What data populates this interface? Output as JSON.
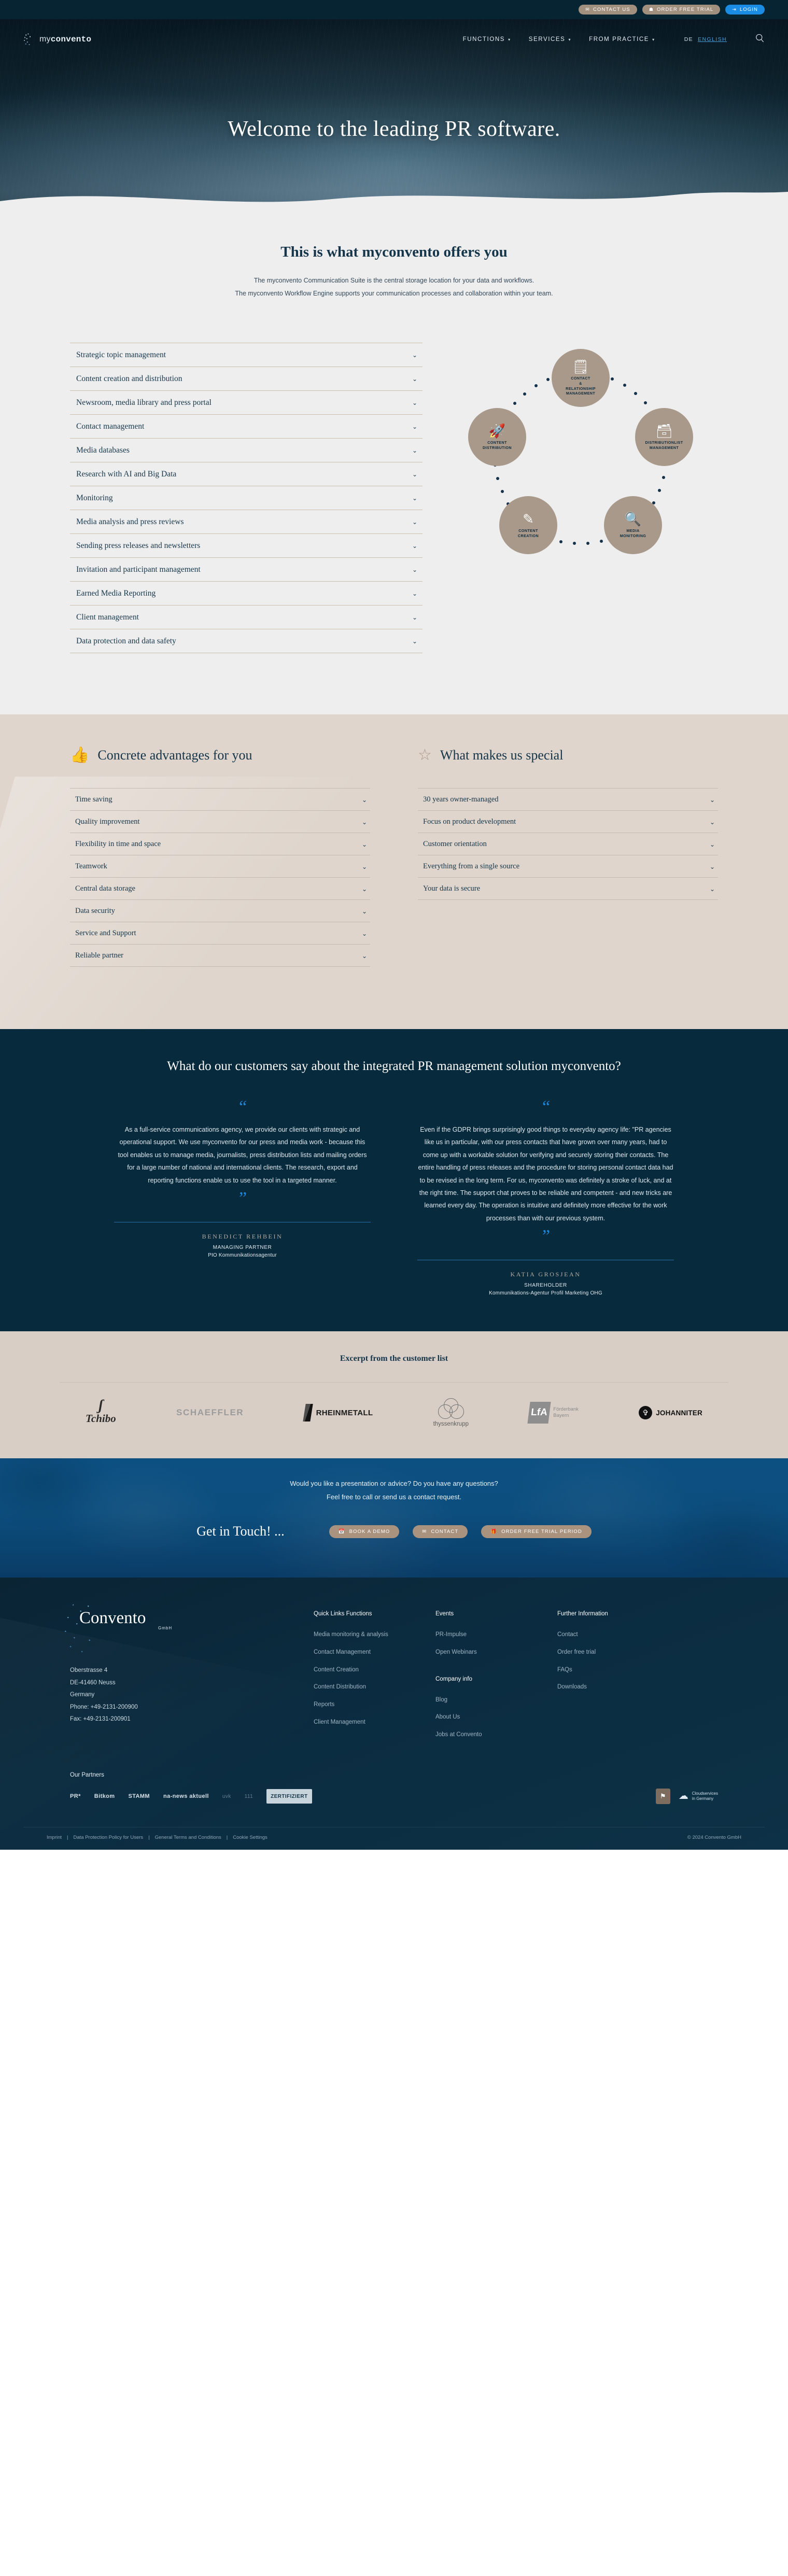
{
  "topbar": {
    "buttons": [
      {
        "label": "CONTACT US",
        "icon": "envelope-icon",
        "glyph": "✉",
        "style": "tan"
      },
      {
        "label": "ORDER FREE TRIAL",
        "icon": "gift-icon",
        "glyph": "☗",
        "style": "tan"
      },
      {
        "label": "LOGIN",
        "icon": "login-arrow-icon",
        "glyph": "→]",
        "style": "blue"
      }
    ]
  },
  "nav": {
    "logo_my": "my",
    "logo_convento": "convento",
    "links": [
      {
        "label": "FUNCTIONS",
        "caret": "⌄"
      },
      {
        "label": "SERVICES",
        "caret": "⌄"
      },
      {
        "label": "FROM PRACTICE",
        "caret": "⌄"
      }
    ],
    "lang_de": "DE",
    "lang_en": "ENGLISH"
  },
  "hero": {
    "title": "Welcome to the leading PR software."
  },
  "offers": {
    "title": "This is what myconvento offers you",
    "sub_line1": "The myconvento Communication Suite is the central storage location for your data and workflows.",
    "sub_line2": "The myconvento Workflow Engine supports your communication processes and collaboration within your team.",
    "accordion": [
      "Strategic topic management",
      "Content creation and distribution",
      "Newsroom, media library and press portal",
      "Contact management",
      "Media databases",
      "Research with AI and Big Data",
      "Monitoring",
      "Media analysis and press reviews",
      "Sending press releases and newsletters",
      "Invitation and participant management",
      "Earned Media Reporting",
      "Client management",
      "Data protection and data safety"
    ],
    "chevron": "⌄",
    "diagram": {
      "nodes": [
        {
          "label": "CONTACT\n&\nRELATIONSHIP\nMANAGEMENT",
          "icon": "address-book-icon",
          "glyph": "📖"
        },
        {
          "label": "DISTRIBUTIONLIST\nMANAGEMENT",
          "icon": "card-stack-icon",
          "glyph": "🗂"
        },
        {
          "label": "MEDIA\nMONITORING",
          "icon": "binoculars-icon",
          "glyph": "🔭"
        },
        {
          "label": "CONTENT\nCREATION",
          "icon": "pen-icon",
          "glyph": "✎"
        },
        {
          "label": "CONTENT\nDISTRIBUTION",
          "icon": "rocket-icon",
          "glyph": "🚀"
        }
      ]
    }
  },
  "advantages": {
    "left": {
      "icon": "thumbs-up-icon",
      "glyph": "👍",
      "title": "Concrete advantages for you",
      "items": [
        "Time saving",
        "Quality improvement",
        "Flexibility in time and space",
        "Teamwork",
        "Central data storage",
        "Data security",
        "Service and Support",
        "Reliable partner"
      ]
    },
    "right": {
      "icon": "star-outline-icon",
      "glyph": "☆",
      "title": "What makes us special",
      "items": [
        "30 years owner-managed",
        "Focus on product development",
        "Customer orientation",
        "Everything from a single source",
        "Your data is secure"
      ]
    },
    "chevron": "⌄"
  },
  "testimonials": {
    "heading": "What do our customers say about the integrated PR management solution myconvento?",
    "quote_open": "“",
    "quote_close": "”",
    "cards": [
      {
        "quote": "As a full-service communications agency, we provide our clients with strategic and operational support. We use myconvento for our press and media work - because this tool enables us to manage media, journalists, press distribution lists and mailing orders for a large number of national and international clients. The research, export and reporting functions enable us to use the tool in a targeted manner.",
        "name": "BENEDICT REHBEIN",
        "role": "MANAGING PARTNER",
        "company": "PIO Kommunikationsagentur"
      },
      {
        "quote": "Even if the GDPR brings surprisingly good things to everyday agency life: \"PR agencies like us in particular, with our press contacts that have grown over many years, had to come up with a workable solution for verifying and securely storing their contacts. The entire handling of press releases and the procedure for storing personal contact data had to be revised in the long term. For us, myconvento was definitely a stroke of luck, and at the right time. The support chat proves to be reliable and competent - and new tricks are learned every day. The operation is intuitive and definitely more effective for the work processes than with our previous system.",
        "name": "KATIA GROSJEAN",
        "role": "SHAREHOLDER",
        "company": "Kommunikations-Agentur Profil Marketing OHG"
      }
    ]
  },
  "customers": {
    "heading": "Excerpt from the customer list",
    "logos": [
      {
        "name": "Tchibo",
        "text": "Tchibo"
      },
      {
        "name": "Schaeffler",
        "text": "SCHAEFFLER"
      },
      {
        "name": "Rheinmetall",
        "text": "RHEINMETALL"
      },
      {
        "name": "thyssenkrupp",
        "text": "thyssenkrupp"
      },
      {
        "name": "LfA Foerderbank Bayern",
        "text": "LfA",
        "sub1": "Förderbank",
        "sub2": "Bayern"
      },
      {
        "name": "Johanniter",
        "text": "JOHANNITER"
      }
    ]
  },
  "cta": {
    "line1": "Would you like a presentation or advice? Do you have any questions?",
    "line2": "Feel free to call or send us a contact request.",
    "title": "Get in Touch! ...",
    "buttons": [
      {
        "label": "BOOK A DEMO",
        "icon": "calendar-icon",
        "glyph": "☷"
      },
      {
        "label": "CONTACT",
        "icon": "envelope-icon",
        "glyph": "✉"
      },
      {
        "label": "ORDER FREE TRIAL PERIOD",
        "icon": "gift-icon",
        "glyph": "☗"
      }
    ]
  },
  "footer": {
    "brand": "Convento",
    "brand_suffix": "GmbH",
    "address": [
      "Oberstrasse 4",
      "DE-41460 Neuss",
      "Germany",
      "Phone: +49-2131-200900",
      "Fax: +49-2131-200901"
    ],
    "columns": [
      {
        "heading": "Quick Links Functions",
        "links": [
          "Media monitoring & analysis",
          "Contact Management",
          "Content Creation",
          "Content Distribution",
          "Reports",
          "Client Management"
        ]
      },
      {
        "heading": "Events",
        "links": [
          "PR-Impulse",
          "Open Webinars"
        ],
        "heading2": "Company info",
        "links2": [
          "Blog",
          "About Us",
          "Jobs at Convento"
        ]
      },
      {
        "heading": "Further Information",
        "links": [
          "Contact",
          "Order free trial",
          "FAQs",
          "Downloads"
        ]
      }
    ],
    "partners_heading": "Our Partners",
    "partners": [
      "PR*",
      "Bitkom",
      "STAMM",
      "na-news aktuell",
      "uvk",
      "111",
      "ZERTIFIZIERT"
    ],
    "seal_glyph": "⚑",
    "cloud_line1": "Cloudservices",
    "cloud_line2": "in Germany",
    "legal_links": [
      "Imprint",
      "Data Protection Policy for Users",
      "General Terms and Conditions",
      "Cookie Settings"
    ],
    "copyright": "© 2024 Convento GmbH"
  }
}
